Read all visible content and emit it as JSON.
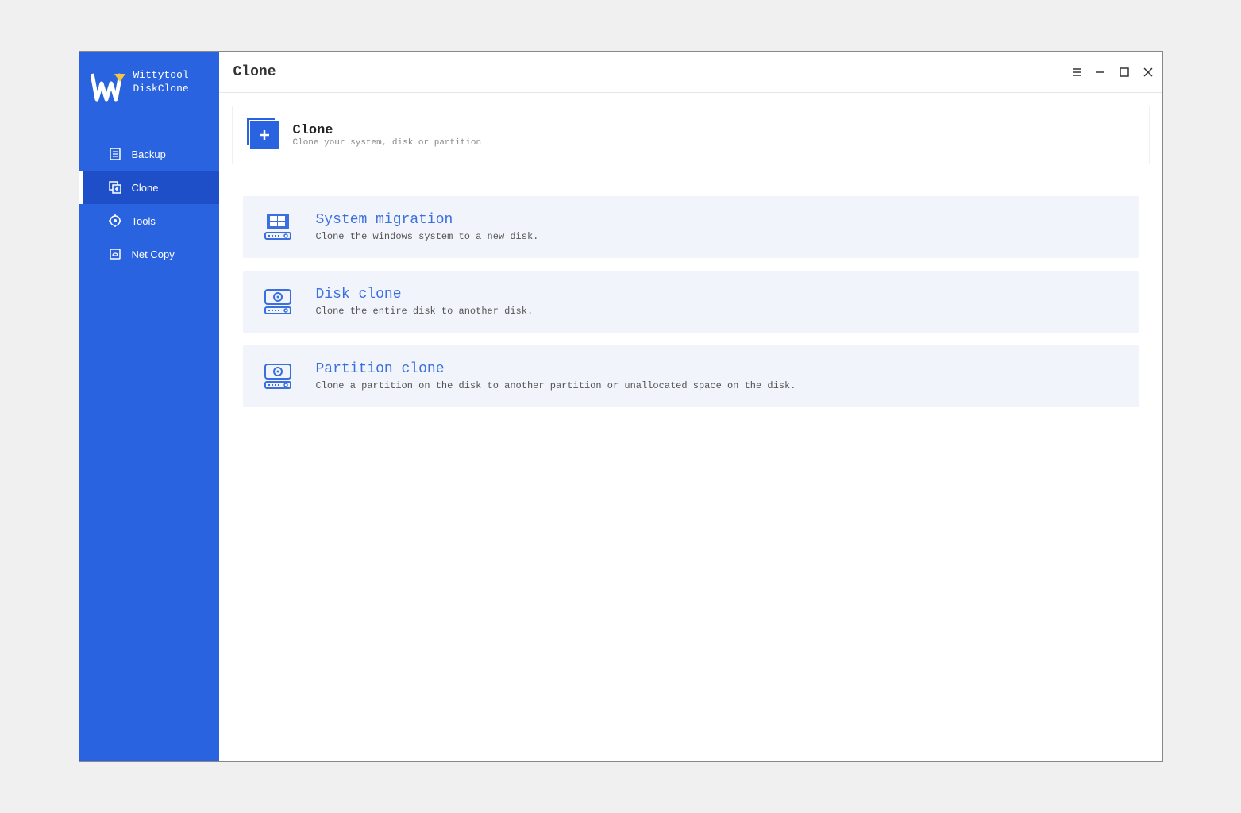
{
  "brand": {
    "line1": "Wittytool",
    "line2": "DiskClone"
  },
  "sidebar": {
    "items": [
      {
        "label": "Backup"
      },
      {
        "label": "Clone"
      },
      {
        "label": "Tools"
      },
      {
        "label": "Net Copy"
      }
    ]
  },
  "page": {
    "title": "Clone"
  },
  "header": {
    "title": "Clone",
    "desc": "Clone your system, disk or partition"
  },
  "options": [
    {
      "title": "System migration",
      "desc": "Clone the windows system to a new disk."
    },
    {
      "title": "Disk clone",
      "desc": "Clone the entire disk to another disk."
    },
    {
      "title": "Partition clone",
      "desc": "Clone a partition on the disk to another partition or unallocated space on the disk."
    }
  ]
}
